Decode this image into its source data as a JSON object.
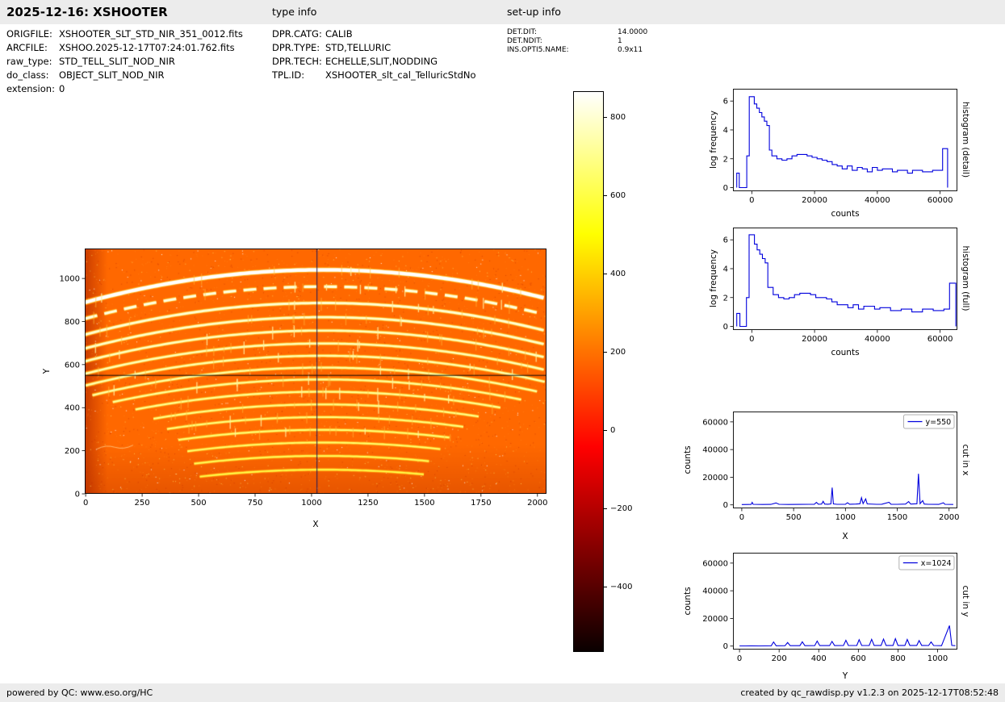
{
  "header": {
    "title": "2025-12-16: XSHOOTER",
    "type_info": "type info",
    "setup_info": "set-up info"
  },
  "file_info": {
    "rows": [
      {
        "label": "ORIGFILE:",
        "value": "XSHOOTER_SLT_STD_NIR_351_0012.fits"
      },
      {
        "label": "ARCFILE:",
        "value": "XSHOO.2025-12-17T07:24:01.762.fits"
      },
      {
        "label": "raw_type:",
        "value": "STD_TELL_SLIT_NOD_NIR"
      },
      {
        "label": "do_class:",
        "value": "OBJECT_SLIT_NOD_NIR"
      },
      {
        "label": "extension:",
        "value": "0"
      }
    ]
  },
  "type_info": {
    "rows": [
      {
        "label": "DPR.CATG:",
        "value": "CALIB"
      },
      {
        "label": "DPR.TYPE:",
        "value": "STD,TELLURIC"
      },
      {
        "label": "DPR.TECH:",
        "value": "ECHELLE,SLIT,NODDING"
      },
      {
        "label": "TPL.ID:",
        "value": "XSHOOTER_slt_cal_TelluricStdNo"
      }
    ]
  },
  "setup_info": {
    "rows": [
      {
        "label": "DET.DIT:",
        "value": "14.0000"
      },
      {
        "label": "DET.NDIT:",
        "value": "1"
      },
      {
        "label": "INS.OPTI5.NAME:",
        "value": "0.9x11"
      }
    ]
  },
  "footer": {
    "left": "powered by QC: www.eso.org/HC",
    "right": "created by qc_rawdisp.py v1.2.3 on 2025-12-17T08:52:48"
  },
  "chart_data": [
    {
      "id": "raw_frame",
      "type": "heatmap",
      "xlabel": "X",
      "ylabel": "Y",
      "xlim": [
        -4,
        2040
      ],
      "ylim": [
        0,
        1139
      ],
      "xticks": [
        0,
        250,
        500,
        750,
        1000,
        1250,
        1500,
        1750,
        2000
      ],
      "yticks": [
        0,
        200,
        400,
        600,
        800,
        1000
      ],
      "colormap": "hot",
      "background_level": 200,
      "crosshair": {
        "x": 1024,
        "y": 550
      },
      "noise_seed": 7,
      "noise_dots": 3200,
      "orders": [
        {
          "apex": 1040,
          "drop": 150,
          "x0": -4,
          "x1": 2040,
          "w": 4.5,
          "intensity": 1.0
        },
        {
          "apex": 962,
          "drop": 148,
          "x0": -4,
          "x1": 2040,
          "w": 3.2,
          "intensity": 0.93,
          "dash": [
            16,
            9
          ]
        },
        {
          "apex": 886,
          "drop": 146,
          "x0": -4,
          "x1": 2040,
          "w": 3.0,
          "intensity": 0.9
        },
        {
          "apex": 820,
          "drop": 144,
          "x0": -4,
          "x1": 2040,
          "w": 2.8,
          "intensity": 0.88
        },
        {
          "apex": 758,
          "drop": 142,
          "x0": -4,
          "x1": 2040,
          "w": 2.6,
          "intensity": 0.86
        },
        {
          "apex": 698,
          "drop": 140,
          "x0": -4,
          "x1": 2040,
          "w": 2.5,
          "intensity": 0.84
        },
        {
          "apex": 641,
          "drop": 138,
          "x0": 0,
          "x1": 2040,
          "w": 2.4,
          "intensity": 0.82
        },
        {
          "apex": 586,
          "drop": 136,
          "x0": 30,
          "x1": 2010,
          "w": 2.3,
          "intensity": 0.8
        },
        {
          "apex": 531,
          "drop": 134,
          "x0": 120,
          "x1": 1930,
          "w": 2.2,
          "intensity": 0.78
        },
        {
          "apex": 474,
          "drop": 132,
          "x0": 220,
          "x1": 1840,
          "w": 2.2,
          "intensity": 0.76
        },
        {
          "apex": 415,
          "drop": 130,
          "x0": 300,
          "x1": 1750,
          "w": 2.1,
          "intensity": 0.74
        },
        {
          "apex": 356,
          "drop": 128,
          "x0": 360,
          "x1": 1680,
          "w": 2.0,
          "intensity": 0.72
        },
        {
          "apex": 297,
          "drop": 126,
          "x0": 410,
          "x1": 1620,
          "w": 2.0,
          "intensity": 0.7
        },
        {
          "apex": 238,
          "drop": 124,
          "x0": 450,
          "x1": 1570,
          "w": 1.9,
          "intensity": 0.68
        },
        {
          "apex": 176,
          "drop": 122,
          "x0": 480,
          "x1": 1530,
          "w": 1.8,
          "intensity": 0.64
        },
        {
          "apex": 112,
          "drop": 120,
          "x0": 505,
          "x1": 1500,
          "w": 1.7,
          "intensity": 0.6
        }
      ]
    },
    {
      "id": "colorbar",
      "type": "colorbar",
      "colormap": "hot",
      "domain": [
        -566,
        868
      ],
      "ticks": [
        800,
        600,
        400,
        200,
        0,
        -200,
        -400
      ]
    },
    {
      "id": "histogram_detail",
      "type": "line",
      "right_label": "histogram (detail)",
      "xlabel": "counts",
      "ylabel": "log frequency",
      "color": "#0000dd",
      "xlim": [
        -6000,
        65500
      ],
      "ylim": [
        -0.25,
        6.85
      ],
      "xticks": [
        0,
        20000,
        40000,
        60000
      ],
      "yticks": [
        0,
        2,
        4,
        6
      ],
      "points": [
        [
          -4800,
          0
        ],
        [
          -4800,
          1.0
        ],
        [
          -4000,
          1.0
        ],
        [
          -4000,
          0
        ],
        [
          -1600,
          0
        ],
        [
          -1600,
          2.2
        ],
        [
          -800,
          2.2
        ],
        [
          -800,
          6.3
        ],
        [
          800,
          6.3
        ],
        [
          800,
          5.8
        ],
        [
          1600,
          5.8
        ],
        [
          1600,
          5.5
        ],
        [
          2400,
          5.5
        ],
        [
          2400,
          5.2
        ],
        [
          3200,
          5.2
        ],
        [
          3200,
          4.9
        ],
        [
          4000,
          4.9
        ],
        [
          4000,
          4.6
        ],
        [
          4800,
          4.6
        ],
        [
          4800,
          4.3
        ],
        [
          5600,
          4.3
        ],
        [
          5600,
          2.6
        ],
        [
          6400,
          2.6
        ],
        [
          6400,
          2.2
        ],
        [
          8000,
          2.2
        ],
        [
          8000,
          2.0
        ],
        [
          9600,
          2.0
        ],
        [
          9600,
          1.9
        ],
        [
          11200,
          1.9
        ],
        [
          11200,
          2.0
        ],
        [
          12800,
          2.0
        ],
        [
          12800,
          2.2
        ],
        [
          14400,
          2.2
        ],
        [
          14400,
          2.3
        ],
        [
          17600,
          2.3
        ],
        [
          17600,
          2.2
        ],
        [
          19200,
          2.2
        ],
        [
          19200,
          2.1
        ],
        [
          20800,
          2.1
        ],
        [
          20800,
          2.0
        ],
        [
          22400,
          2.0
        ],
        [
          22400,
          1.9
        ],
        [
          24000,
          1.9
        ],
        [
          24000,
          1.8
        ],
        [
          25600,
          1.8
        ],
        [
          25600,
          1.6
        ],
        [
          27200,
          1.6
        ],
        [
          27200,
          1.5
        ],
        [
          28800,
          1.5
        ],
        [
          28800,
          1.3
        ],
        [
          30400,
          1.3
        ],
        [
          30400,
          1.5
        ],
        [
          32000,
          1.5
        ],
        [
          32000,
          1.2
        ],
        [
          33600,
          1.2
        ],
        [
          33600,
          1.4
        ],
        [
          35200,
          1.4
        ],
        [
          35200,
          1.3
        ],
        [
          36800,
          1.3
        ],
        [
          36800,
          1.1
        ],
        [
          38400,
          1.1
        ],
        [
          38400,
          1.4
        ],
        [
          40000,
          1.4
        ],
        [
          40000,
          1.2
        ],
        [
          41600,
          1.2
        ],
        [
          41600,
          1.3
        ],
        [
          44800,
          1.3
        ],
        [
          44800,
          1.1
        ],
        [
          46400,
          1.1
        ],
        [
          46400,
          1.2
        ],
        [
          49600,
          1.2
        ],
        [
          49600,
          1.0
        ],
        [
          51200,
          1.0
        ],
        [
          51200,
          1.2
        ],
        [
          54400,
          1.2
        ],
        [
          54400,
          1.1
        ],
        [
          57600,
          1.1
        ],
        [
          57600,
          1.2
        ],
        [
          60800,
          1.2
        ],
        [
          60800,
          2.7
        ],
        [
          62400,
          2.7
        ],
        [
          62400,
          0
        ]
      ]
    },
    {
      "id": "histogram_full",
      "type": "line",
      "right_label": "histogram (full)",
      "xlabel": "counts",
      "ylabel": "log frequency",
      "color": "#0000dd",
      "xlim": [
        -6000,
        65500
      ],
      "ylim": [
        -0.25,
        6.85
      ],
      "xticks": [
        0,
        20000,
        40000,
        60000
      ],
      "yticks": [
        0,
        2,
        4,
        6
      ],
      "points": [
        [
          -4800,
          0
        ],
        [
          -4800,
          0.9
        ],
        [
          -3800,
          0.9
        ],
        [
          -3800,
          0
        ],
        [
          -1700,
          0
        ],
        [
          -1700,
          2.0
        ],
        [
          -850,
          2.0
        ],
        [
          -850,
          6.35
        ],
        [
          850,
          6.35
        ],
        [
          850,
          5.7
        ],
        [
          1700,
          5.7
        ],
        [
          1700,
          5.3
        ],
        [
          2550,
          5.3
        ],
        [
          2550,
          5.0
        ],
        [
          3400,
          5.0
        ],
        [
          3400,
          4.7
        ],
        [
          4250,
          4.7
        ],
        [
          4250,
          4.4
        ],
        [
          5100,
          4.4
        ],
        [
          5100,
          2.7
        ],
        [
          6800,
          2.7
        ],
        [
          6800,
          2.2
        ],
        [
          8500,
          2.2
        ],
        [
          8500,
          2.0
        ],
        [
          10200,
          2.0
        ],
        [
          10200,
          1.9
        ],
        [
          11900,
          1.9
        ],
        [
          11900,
          2.0
        ],
        [
          13600,
          2.0
        ],
        [
          13600,
          2.2
        ],
        [
          15300,
          2.2
        ],
        [
          15300,
          2.3
        ],
        [
          18700,
          2.3
        ],
        [
          18700,
          2.2
        ],
        [
          20400,
          2.2
        ],
        [
          20400,
          2.0
        ],
        [
          23800,
          2.0
        ],
        [
          23800,
          1.9
        ],
        [
          25500,
          1.9
        ],
        [
          25500,
          1.7
        ],
        [
          27200,
          1.7
        ],
        [
          27200,
          1.5
        ],
        [
          30600,
          1.5
        ],
        [
          30600,
          1.3
        ],
        [
          32300,
          1.3
        ],
        [
          32300,
          1.5
        ],
        [
          34000,
          1.5
        ],
        [
          34000,
          1.2
        ],
        [
          35700,
          1.2
        ],
        [
          35700,
          1.4
        ],
        [
          39100,
          1.4
        ],
        [
          39100,
          1.2
        ],
        [
          40800,
          1.2
        ],
        [
          40800,
          1.3
        ],
        [
          44200,
          1.3
        ],
        [
          44200,
          1.1
        ],
        [
          47600,
          1.1
        ],
        [
          47600,
          1.2
        ],
        [
          51000,
          1.2
        ],
        [
          51000,
          1.0
        ],
        [
          54400,
          1.0
        ],
        [
          54400,
          1.2
        ],
        [
          57800,
          1.2
        ],
        [
          57800,
          1.1
        ],
        [
          61200,
          1.1
        ],
        [
          61200,
          1.2
        ],
        [
          63000,
          1.2
        ],
        [
          63000,
          3.0
        ],
        [
          65000,
          3.0
        ],
        [
          65000,
          0
        ]
      ]
    },
    {
      "id": "cut_in_x",
      "type": "line",
      "legend": "y=550",
      "right_label": "cut in x",
      "xlabel": "X",
      "ylabel": "counts",
      "color": "#0000dd",
      "xlim": [
        -85,
        2080
      ],
      "ylim": [
        -2500,
        67500
      ],
      "xticks": [
        0,
        500,
        1000,
        1500,
        2000
      ],
      "yticks": [
        0,
        20000,
        40000,
        60000
      ],
      "points": [
        [
          0,
          250
        ],
        [
          60,
          300
        ],
        [
          90,
          350
        ],
        [
          100,
          1800
        ],
        [
          110,
          400
        ],
        [
          200,
          300
        ],
        [
          280,
          350
        ],
        [
          330,
          1400
        ],
        [
          360,
          400
        ],
        [
          450,
          300
        ],
        [
          560,
          350
        ],
        [
          650,
          400
        ],
        [
          700,
          500
        ],
        [
          720,
          1800
        ],
        [
          740,
          500
        ],
        [
          770,
          600
        ],
        [
          785,
          2600
        ],
        [
          800,
          600
        ],
        [
          830,
          500
        ],
        [
          860,
          700
        ],
        [
          872,
          12500
        ],
        [
          884,
          700
        ],
        [
          920,
          400
        ],
        [
          1000,
          500
        ],
        [
          1020,
          1500
        ],
        [
          1040,
          500
        ],
        [
          1100,
          600
        ],
        [
          1140,
          800
        ],
        [
          1155,
          5200
        ],
        [
          1170,
          900
        ],
        [
          1195,
          4300
        ],
        [
          1210,
          700
        ],
        [
          1300,
          400
        ],
        [
          1350,
          500
        ],
        [
          1420,
          1900
        ],
        [
          1440,
          500
        ],
        [
          1500,
          400
        ],
        [
          1580,
          600
        ],
        [
          1610,
          2400
        ],
        [
          1630,
          600
        ],
        [
          1690,
          800
        ],
        [
          1705,
          22500
        ],
        [
          1720,
          900
        ],
        [
          1745,
          3100
        ],
        [
          1760,
          600
        ],
        [
          1800,
          400
        ],
        [
          1900,
          350
        ],
        [
          1945,
          1500
        ],
        [
          1960,
          400
        ],
        [
          2040,
          300
        ]
      ]
    },
    {
      "id": "cut_in_y",
      "type": "line",
      "legend": "x=1024",
      "right_label": "cut in y",
      "xlabel": "Y",
      "ylabel": "counts",
      "color": "#0000dd",
      "xlim": [
        -33,
        1100
      ],
      "ylim": [
        -2500,
        67500
      ],
      "xticks": [
        0,
        200,
        400,
        600,
        800,
        1000
      ],
      "yticks": [
        0,
        20000,
        40000,
        60000
      ],
      "points": [
        [
          0,
          100
        ],
        [
          30,
          150
        ],
        [
          60,
          200
        ],
        [
          100,
          150
        ],
        [
          160,
          250
        ],
        [
          172,
          3000
        ],
        [
          185,
          250
        ],
        [
          230,
          300
        ],
        [
          243,
          2600
        ],
        [
          256,
          300
        ],
        [
          305,
          300
        ],
        [
          317,
          3100
        ],
        [
          330,
          300
        ],
        [
          380,
          350
        ],
        [
          392,
          3600
        ],
        [
          405,
          350
        ],
        [
          455,
          350
        ],
        [
          467,
          3400
        ],
        [
          480,
          350
        ],
        [
          525,
          400
        ],
        [
          537,
          4200
        ],
        [
          550,
          400
        ],
        [
          592,
          400
        ],
        [
          604,
          4600
        ],
        [
          617,
          400
        ],
        [
          655,
          450
        ],
        [
          667,
          4900
        ],
        [
          680,
          450
        ],
        [
          715,
          500
        ],
        [
          727,
          5100
        ],
        [
          740,
          500
        ],
        [
          775,
          500
        ],
        [
          787,
          5400
        ],
        [
          800,
          500
        ],
        [
          835,
          500
        ],
        [
          847,
          4800
        ],
        [
          860,
          500
        ],
        [
          895,
          450
        ],
        [
          907,
          4000
        ],
        [
          920,
          450
        ],
        [
          955,
          400
        ],
        [
          967,
          3000
        ],
        [
          980,
          400
        ],
        [
          1020,
          300
        ],
        [
          1060,
          14800
        ],
        [
          1072,
          500
        ],
        [
          1090,
          300
        ]
      ]
    }
  ]
}
